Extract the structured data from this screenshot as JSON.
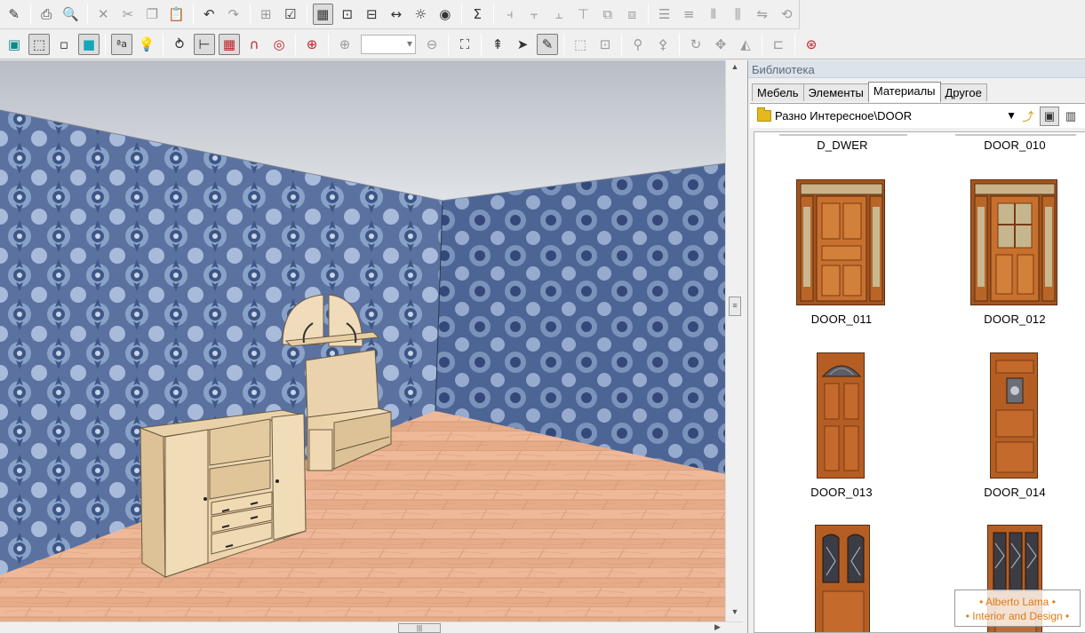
{
  "toolbar_top": {
    "icons": [
      "new-icon",
      "print-icon",
      "print-preview-icon",
      "cut-icon",
      "scissors-icon",
      "copy-icon",
      "paste-icon",
      "undo-icon",
      "redo-icon",
      "properties-icon",
      "check-icon",
      "view-plan-icon",
      "view-zoom-icon",
      "view-dimension-icon",
      "view-width-icon",
      "view-light-icon",
      "view-render-icon",
      "sum-icon",
      "align-left-icon",
      "align-center-icon",
      "align-right-icon",
      "align-top-icon",
      "group-icon",
      "ungroup-icon",
      "distribute-h-icon",
      "distribute-h2-icon",
      "distribute-v-icon",
      "distribute-v2-icon",
      "mirror-icon",
      "rotate-icon"
    ],
    "sum_label": "Σ"
  },
  "toolbar_bottom": {
    "text_style_label": "ªa",
    "zoom_value": ""
  },
  "library": {
    "title": "Библиотека",
    "tabs": [
      "Мебель",
      "Элементы",
      "Материалы",
      "Другое"
    ],
    "active_tab": "Материалы",
    "path": "Разно Интересное\\DOOR",
    "items": [
      {
        "label": "D_DWER"
      },
      {
        "label": "DOOR_010"
      },
      {
        "label": "DOOR_011"
      },
      {
        "label": "DOOR_012"
      },
      {
        "label": "DOOR_013"
      },
      {
        "label": "DOOR_014"
      },
      {
        "label": ""
      },
      {
        "label": ""
      }
    ]
  },
  "watermark": {
    "line1": "• Alberto Lama •",
    "line2": "• Interior and Design •"
  }
}
